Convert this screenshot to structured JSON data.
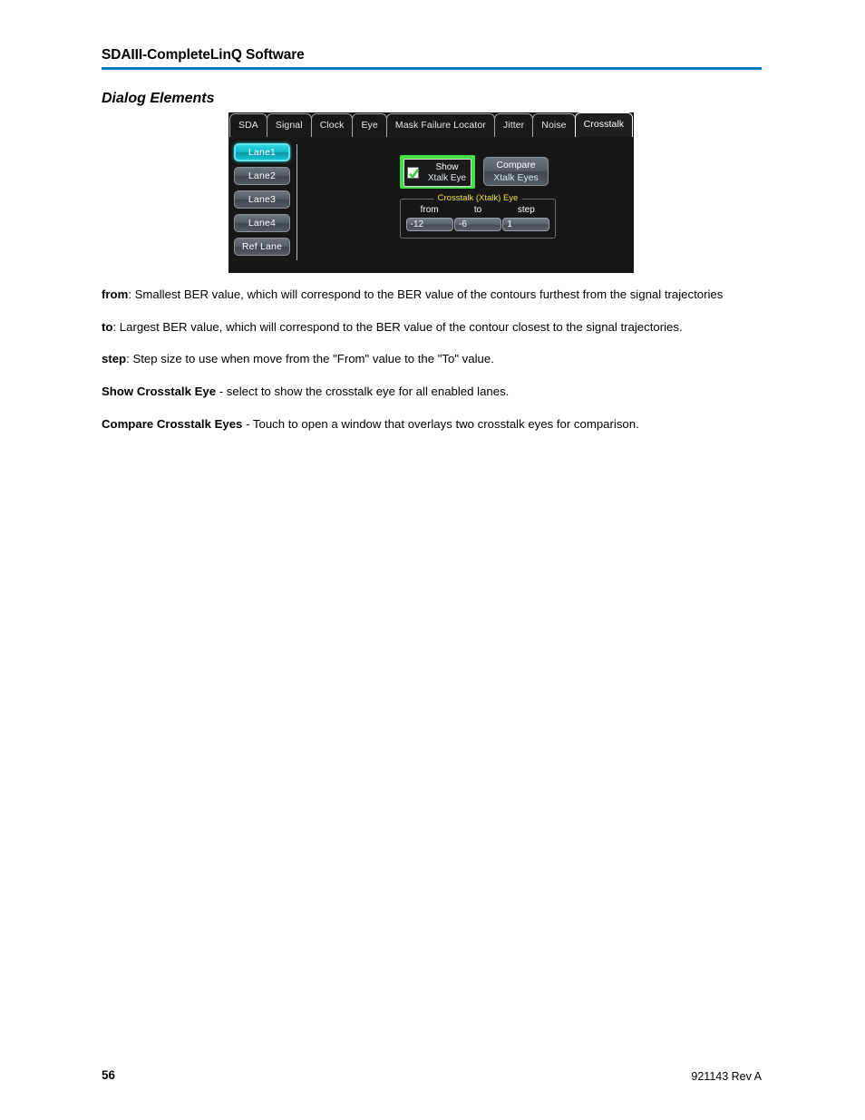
{
  "document": {
    "header_title": "SDAIII-CompleteLinQ Software",
    "section_heading": "Dialog Elements",
    "page_number": "56",
    "doc_number": "921143 Rev A",
    "rule_color": "#0b74bd"
  },
  "screenshot": {
    "tabs": [
      {
        "label": "SDA",
        "active": false
      },
      {
        "label": "Signal",
        "active": false
      },
      {
        "label": "Clock",
        "active": false
      },
      {
        "label": "Eye",
        "active": false
      },
      {
        "label": "Mask Failure Locator",
        "active": false
      },
      {
        "label": "Jitter",
        "active": false
      },
      {
        "label": "Noise",
        "active": false
      },
      {
        "label": "Crosstalk",
        "active": true
      }
    ],
    "lanes": [
      {
        "label": "Lane1",
        "selected": true
      },
      {
        "label": "Lane2",
        "selected": false
      },
      {
        "label": "Lane3",
        "selected": false
      },
      {
        "label": "Lane4",
        "selected": false
      },
      {
        "label": "Ref Lane",
        "selected": false
      }
    ],
    "show_xtalk_eye": {
      "line1": "Show",
      "line2": "Xtalk Eye",
      "checked": true,
      "focus_color": "#45e045",
      "check_color": "#3cc63c"
    },
    "compare_button": {
      "line1": "Compare",
      "line2": "Xtalk Eyes"
    },
    "group": {
      "title": "Crosstalk (Xtalk) Eye",
      "title_color": "#f2e33a",
      "fields": [
        {
          "label": "from",
          "value": "-12"
        },
        {
          "label": "to",
          "value": "-6"
        },
        {
          "label": "step",
          "value": "1"
        }
      ]
    },
    "selected_lane_color": "#2dd9e3"
  },
  "descriptions": [
    {
      "term": "from",
      "text": ": Smallest BER value, which will correspond to the BER value of the contours furthest from the signal trajectories"
    },
    {
      "term": "to",
      "text": ": Largest BER value, which will correspond to the BER value of the contour closest to the signal trajectories."
    },
    {
      "term": "step",
      "text": ": Step size to use when move from the \"From\" value to the \"To\" value."
    },
    {
      "term": "Show Crosstalk Eye",
      "text": " - select to show the crosstalk eye for all enabled lanes."
    },
    {
      "term": "Compare Crosstalk Eyes",
      "text": " - Touch to open a window that overlays two crosstalk eyes for comparison."
    }
  ]
}
